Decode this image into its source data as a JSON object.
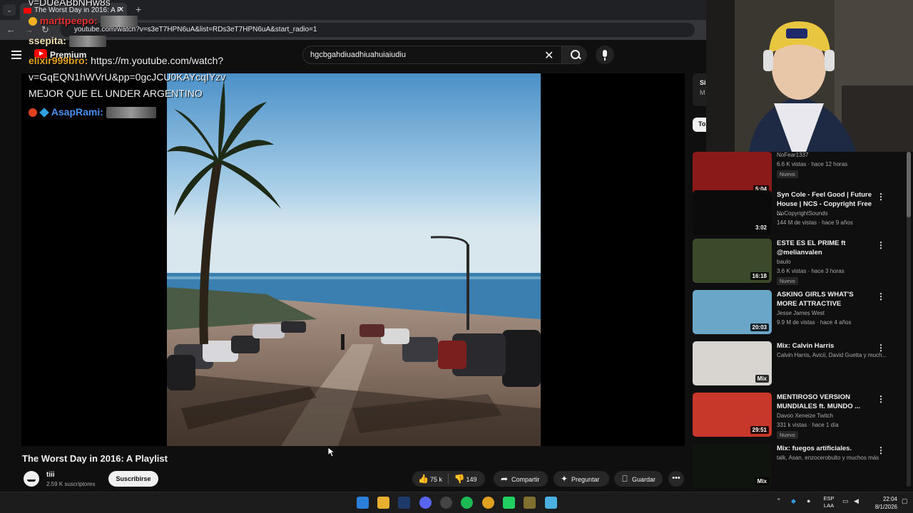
{
  "browser": {
    "tab_title": "The Worst Day in 2016: A P",
    "url": "youtube.com/watch?v=s3eT7HPN6uA&list=RDs3eT7HPN6uA&start_radio=1"
  },
  "header": {
    "logo_label": "Premium",
    "search_value": "hgcbgahdiuadhiuahuiaiudiu"
  },
  "chat": {
    "top_cut": "v=DUeABbNHw8s",
    "msg1_user": "marttpeepo:",
    "msg2_user": "ssepita:",
    "msg3_user": "elixir999bro:",
    "msg3_text": "https://m.youtube.com/watch?",
    "msg3_line2": "v=GqEQN1hWVrU&pp=0gcJCU0KAYcqIYzv",
    "msg3_line3": "MEJOR QUE EL UNDER ARGENTINO",
    "msg4_user": "AsapRami:"
  },
  "video": {
    "title": "The Worst Day in 2016: A Playlist",
    "channel": "tiii",
    "subscribers": "2.59 K suscriptores",
    "subscribe_label": "Suscribirse",
    "likes": "75 k",
    "dislikes": "149",
    "share_label": "Compartir",
    "ask_label": "Preguntar",
    "save_label": "Guardar"
  },
  "sidebar": {
    "card_text_1": "Si",
    "card_text_2": "M",
    "chip_label": "To",
    "recommendations": [
      {
        "title": "",
        "channel": "NoFear1337",
        "meta": "6.6 K vistas · hace 12 horas",
        "badge": "Nuevo",
        "duration": "5:04",
        "thumb_color": "#8a1a1a"
      },
      {
        "title": "Syn Cole - Feel Good | Future House | NCS - Copyright Free ...",
        "channel": "NoCopyrightSounds",
        "meta": "144 M de vistas · hace 9 años",
        "badge": "",
        "duration": "3:02",
        "thumb_color": "#0b0b0b"
      },
      {
        "title": "ESTE ES EL PRIME ft @melianvalen",
        "channel": "baulo",
        "meta": "3.6 K vistas · hace 3 horas",
        "badge": "Nuevo",
        "duration": "16:18",
        "thumb_color": "#3a4a2a"
      },
      {
        "title": "ASKING GIRLS WHAT'S MORE ATTRACTIVE",
        "channel": "Jesse James West",
        "meta": "9.9 M de vistas · hace 4 años",
        "badge": "",
        "duration": "20:03",
        "thumb_color": "#6aa6c8"
      },
      {
        "title": "Mix: Calvin Harris",
        "channel": "Calvin Harris, Avicii, David Guetta y much...",
        "meta": "",
        "badge": "",
        "duration": "Mix",
        "thumb_color": "#d8d4cf"
      },
      {
        "title": "MENTIROSO VERSION MUNDIALES ft. MUNDO ...",
        "channel": "Davoo Xeneize Twitch",
        "meta": "331 k vistas · hace 1 día",
        "badge": "Nuevo",
        "duration": "29:51",
        "thumb_color": "#c8382a"
      },
      {
        "title": "Mix: fuegos artificiales.",
        "channel": "talk, Asan, enzocerobulto y muchos más",
        "meta": "",
        "badge": "",
        "duration": "Mix",
        "thumb_color": "#10140e"
      }
    ]
  },
  "taskbar": {
    "lang_line1": "ESP",
    "lang_line2": "LAA",
    "time": "22:04",
    "date": "8/1/2026"
  }
}
